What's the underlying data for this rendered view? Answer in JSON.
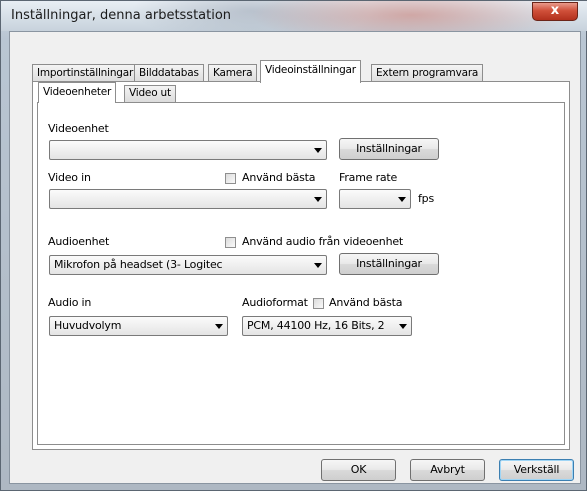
{
  "window": {
    "title": "Inställningar, denna arbetsstation",
    "close_label": "x"
  },
  "tabs": [
    "Importinställningar",
    "Bilddatabas",
    "Kamera",
    "Videoinställningar",
    "Extern programvara"
  ],
  "active_tab": "Videoinställningar",
  "subtabs": [
    "Videoenheter",
    "Video ut"
  ],
  "active_subtab": "Videoenheter",
  "form": {
    "videoenhet_label": "Videoenhet",
    "videoenhet_value": "",
    "video_settings_button": "Inställningar",
    "video_in_label": "Video in",
    "video_in_best_label": "Använd bästa",
    "video_in_best_checked": false,
    "video_in_value": "",
    "frame_rate_label": "Frame rate",
    "frame_rate_value": "",
    "fps_label": "fps",
    "audioenhet_label": "Audioenhet",
    "audio_from_video_label": "Använd audio från videoenhet",
    "audio_from_video_checked": false,
    "audioenhet_value": "Mikrofon på headset (3- Logitec",
    "audio_settings_button": "Inställningar",
    "audio_in_label": "Audio in",
    "audio_in_value": "Huvudvolym",
    "audioformat_label": "Audioformat",
    "audioformat_best_label": "Använd bästa",
    "audioformat_best_checked": false,
    "audioformat_value": "PCM, 44100 Hz, 16 Bits, 2"
  },
  "buttons": {
    "ok": "OK",
    "cancel": "Avbryt",
    "apply": "Verkställ"
  },
  "icons": {
    "close": "close-icon",
    "dropdown": "chevron-down-icon"
  },
  "colors": {
    "default_button_border": "#3c7fb1",
    "close_button": "#c8412b"
  }
}
